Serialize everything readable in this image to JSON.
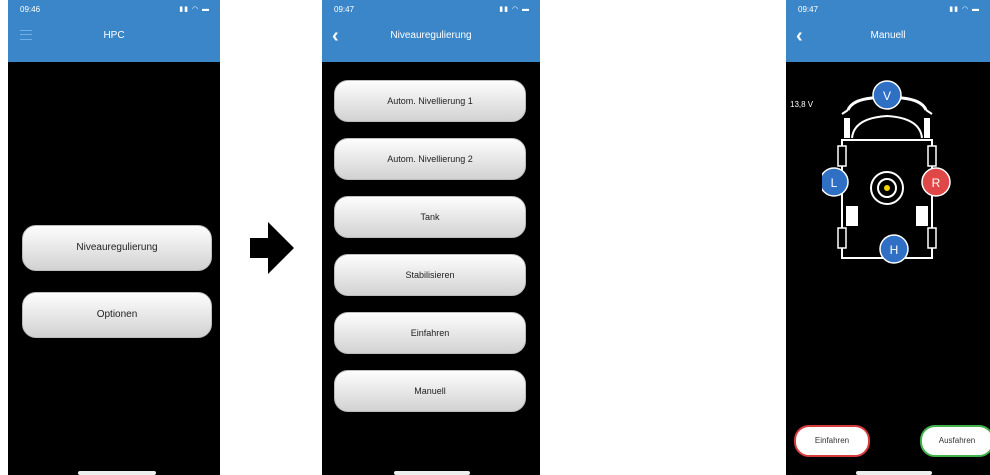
{
  "screen1": {
    "time": "09:46",
    "title": "HPC",
    "buttons": [
      "Niveauregulierung",
      "Optionen"
    ]
  },
  "screen2": {
    "time": "09:47",
    "title": "Niveauregulierung",
    "buttons": [
      "Autom. Nivellierung 1",
      "Autom. Nivellierung 2",
      "Tank",
      "Stabilisieren",
      "Einfahren",
      "Manuell"
    ]
  },
  "screen3": {
    "time": "09:47",
    "title": "Manuell",
    "voltage": "13,8 V",
    "legs": {
      "front": "V",
      "left": "L",
      "right": "R",
      "rear": "H"
    },
    "buttons": {
      "retract": "Einfahren",
      "extend": "Ausfahren"
    }
  },
  "colors": {
    "nav_blue": "#3a86c8",
    "leg_blue": "#2f6fc4",
    "leg_red": "#e04848",
    "retract_border": "#d83b3b",
    "extend_border": "#3fb34a",
    "bubble_yellow": "#f2d400"
  },
  "icons": [
    "hamburger-icon",
    "back-icon",
    "signal-icon",
    "wifi-icon",
    "battery-icon",
    "arrow-right-icon"
  ]
}
